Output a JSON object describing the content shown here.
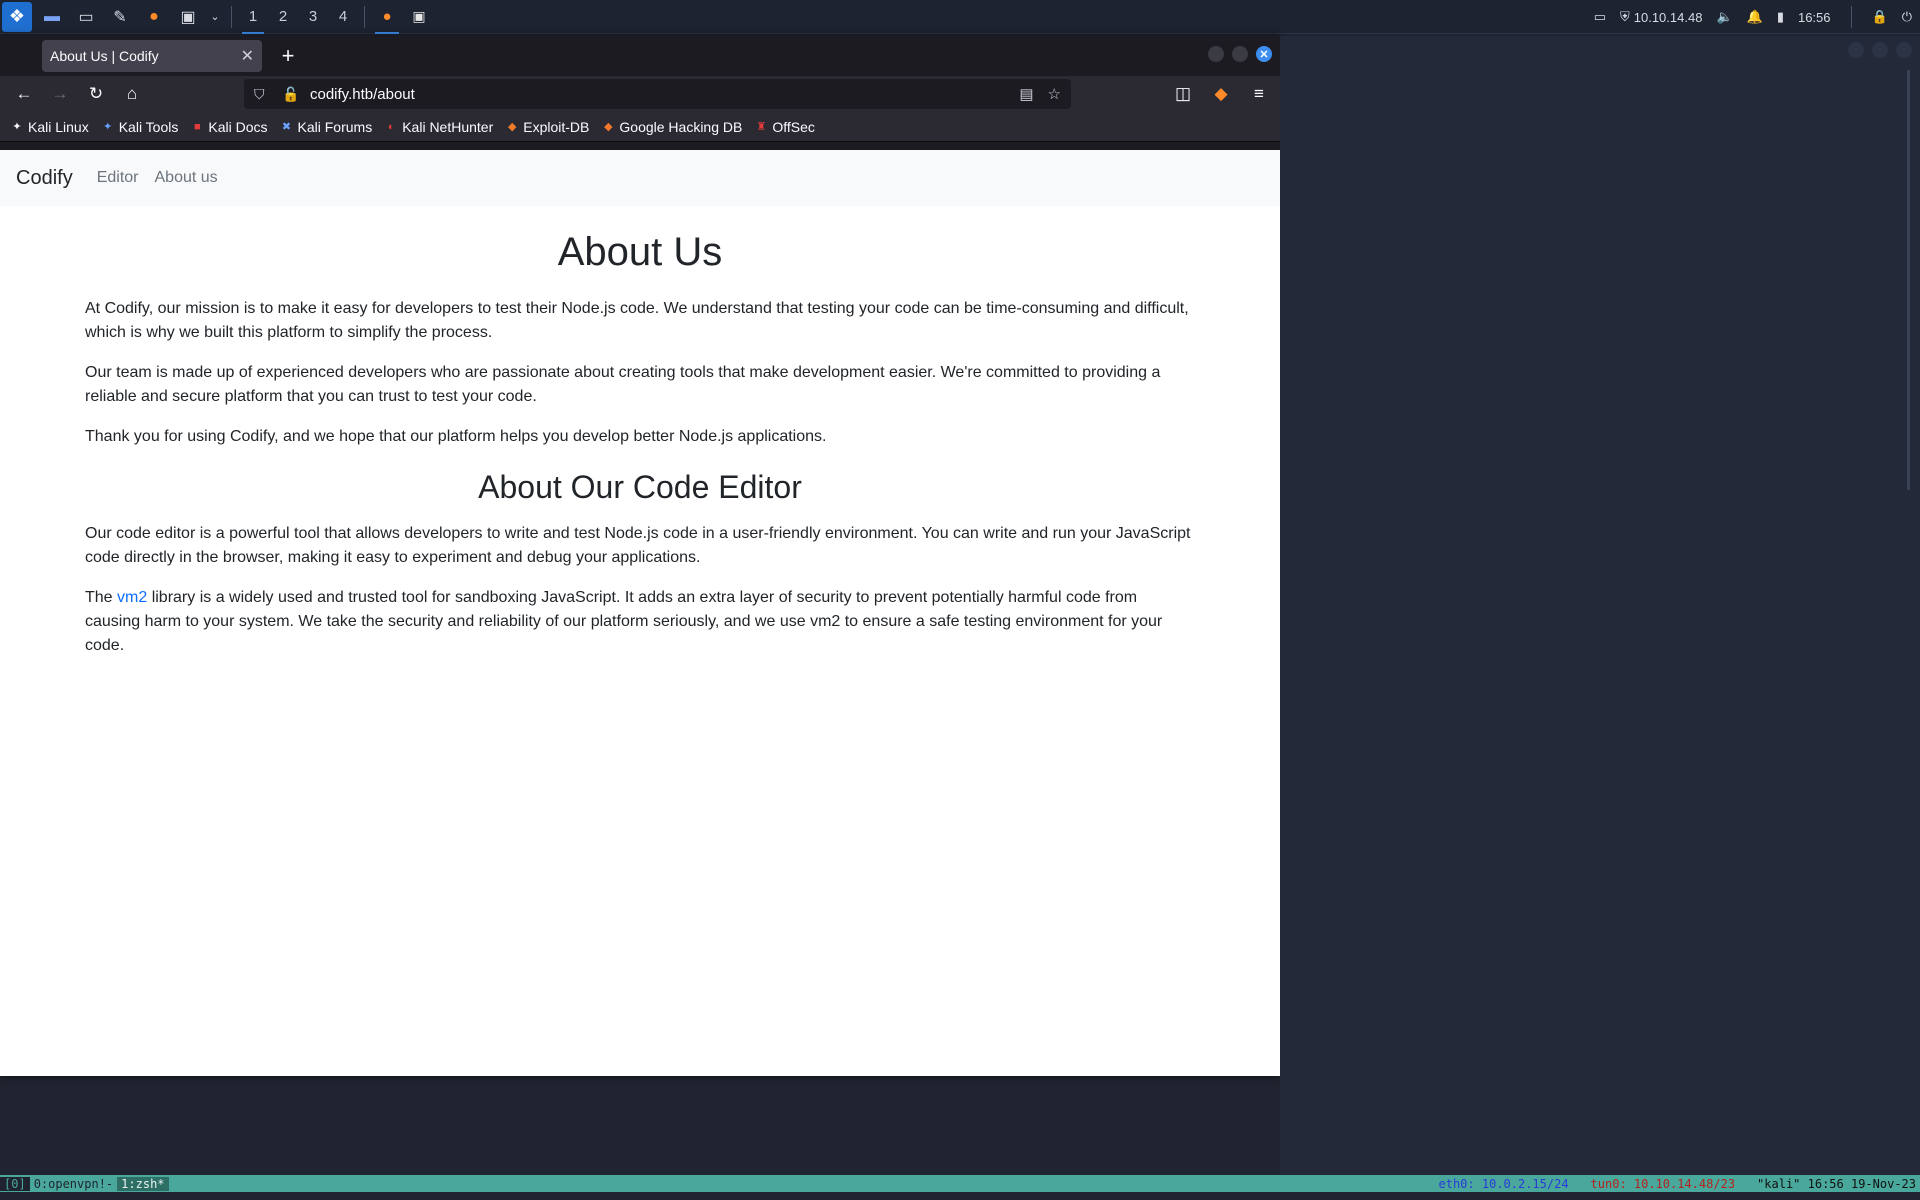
{
  "taskbar": {
    "workspaces": [
      "1",
      "2",
      "3",
      "4"
    ],
    "active_workspace": "1",
    "ip": "10.10.14.48",
    "clock": "16:56"
  },
  "browser": {
    "tab_title": "About Us | Codify",
    "url": "codify.htb/about",
    "bookmarks": [
      "Kali Linux",
      "Kali Tools",
      "Kali Docs",
      "Kali Forums",
      "Kali NetHunter",
      "Exploit-DB",
      "Google Hacking DB",
      "OffSec"
    ]
  },
  "site": {
    "brand": "Codify",
    "nav": [
      "Editor",
      "About us"
    ],
    "heading1": "About Us",
    "para1": "At Codify, our mission is to make it easy for developers to test their Node.js code. We understand that testing your code can be time-consuming and difficult, which is why we built this platform to simplify the process.",
    "para2": "Our team is made up of experienced developers who are passionate about creating tools that make development easier. We're committed to providing a reliable and secure platform that you can trust to test your code.",
    "para3": "Thank you for using Codify, and we hope that our platform helps you develop better Node.js applications.",
    "heading2": "About Our Code Editor",
    "para4": "Our code editor is a powerful tool that allows developers to write and test Node.js code in a user-friendly environment. You can write and run your JavaScript code directly in the browser, making it easy to experiment and debug your applications.",
    "para5_pre": "The ",
    "para5_link": "vm2",
    "para5_post": " library is a widely used and trusted tool for sandboxing JavaScript. It adds an extra layer of security to prevent potentially harmful code from causing harm to your system. We take the security and reliability of our platform seriously, and we use vm2 to ensure a safe testing environment for your code."
  },
  "tmux": {
    "session": "[0]",
    "window0": "0:openvpn!-",
    "window1": "1:zsh*",
    "eth": "eth0: 10.0.2.15/24",
    "tun": "tun0: 10.10.14.48/23",
    "host": "\"kali\" 16:56 19-Nov-23"
  },
  "colors": {
    "accent": "#3d8ef0",
    "link": "#0d6efd",
    "tmux_bar": "#49a89b"
  }
}
